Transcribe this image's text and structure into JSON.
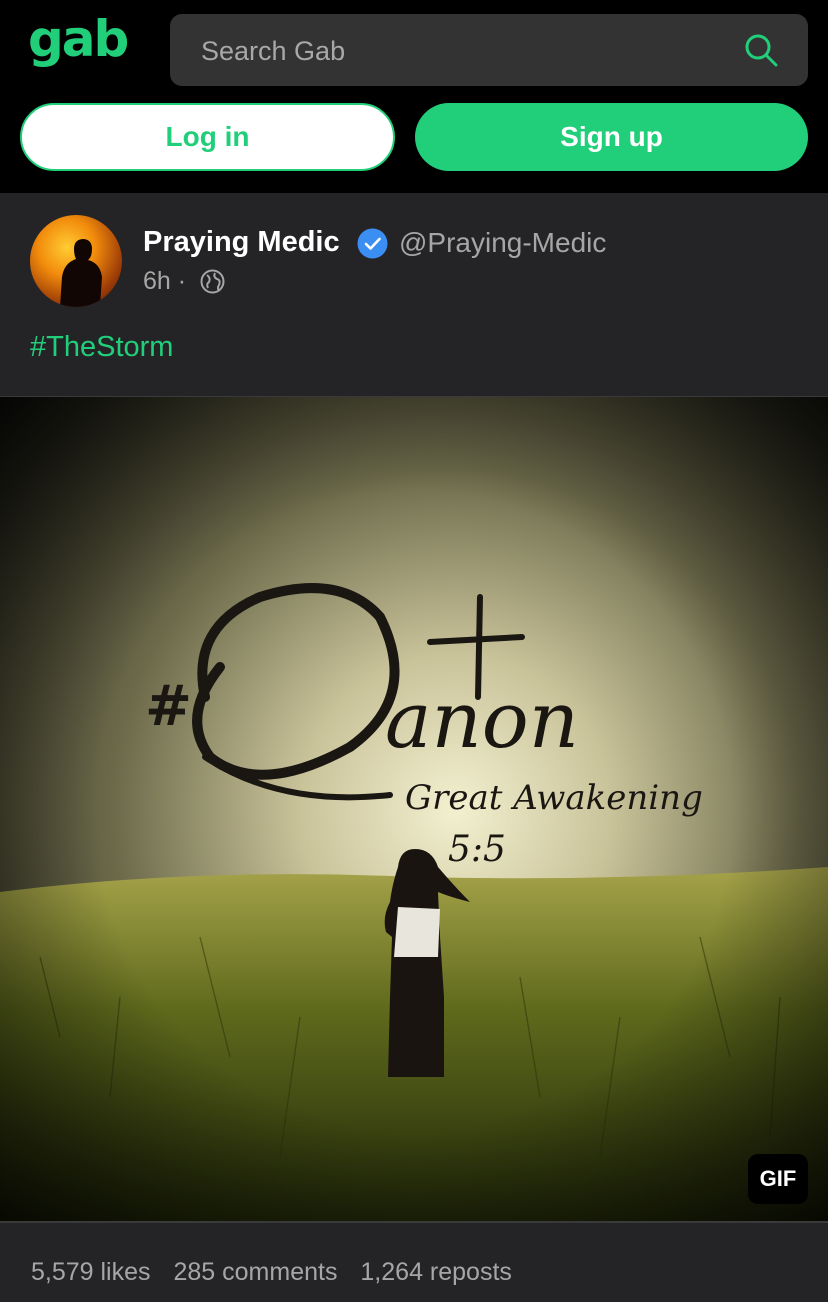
{
  "header": {
    "logo": "gab",
    "search_placeholder": "Search Gab",
    "login_label": "Log in",
    "signup_label": "Sign up"
  },
  "post": {
    "author_name": "Praying Medic",
    "author_handle": "@Praying-Medic",
    "time": "6h",
    "separator": "·",
    "hashtag": "#TheStorm",
    "media": {
      "title_text": "#Qanon",
      "subtitle_text": "Great Awakening",
      "ref_text": "5:5",
      "badge": "GIF"
    },
    "stats": {
      "likes": "5,579 likes",
      "comments": "285 comments",
      "reposts": "1,264 reposts"
    }
  },
  "colors": {
    "accent": "#21cf7a",
    "background": "#000000",
    "card": "#242426",
    "muted_text": "#a6a6a6",
    "verified": "#3b8ff3"
  }
}
